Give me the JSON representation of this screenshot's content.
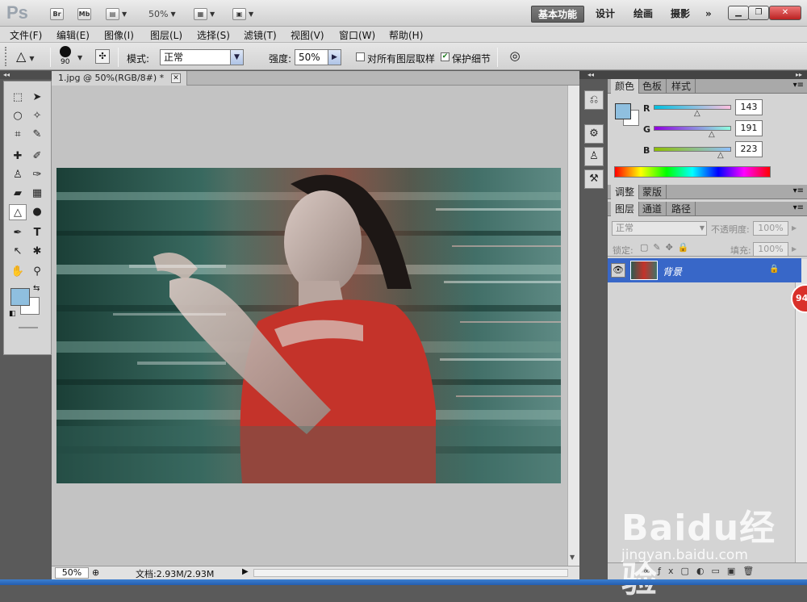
{
  "app": {
    "logo": "Ps",
    "launch_buttons": [
      "Br",
      "Mb"
    ],
    "zoom": "50%"
  },
  "workspaces": [
    "基本功能",
    "设计",
    "绘画",
    "摄影",
    "»"
  ],
  "menus": [
    "文件(F)",
    "编辑(E)",
    "图像(I)",
    "图层(L)",
    "选择(S)",
    "滤镜(T)",
    "视图(V)",
    "窗口(W)",
    "帮助(H)"
  ],
  "options": {
    "brush_size": "90",
    "mode_label": "模式:",
    "mode_value": "正常",
    "strength_label": "强度:",
    "strength_value": "50%",
    "sample_all_label": "对所有图层取样",
    "protect_detail_label": "保护细节",
    "sample_all_checked": false,
    "protect_detail_checked": true
  },
  "document": {
    "tab_title": "1.jpg @ 50%(RGB/8#) *",
    "zoom_status": "50%",
    "doc_info": "文档:2.93M/2.93M"
  },
  "color_panel": {
    "tabs": [
      "颜色",
      "色板",
      "样式"
    ],
    "channels": [
      {
        "name": "R",
        "value": "143",
        "fraction": 0.56
      },
      {
        "name": "G",
        "value": "191",
        "fraction": 0.75
      },
      {
        "name": "B",
        "value": "223",
        "fraction": 0.87
      }
    ],
    "foreground": "#8fbfdf",
    "background": "#ffffff"
  },
  "adjust_panel": {
    "tabs": [
      "调整",
      "蒙版"
    ]
  },
  "layers_panel": {
    "tabs": [
      "图层",
      "通道",
      "路径"
    ],
    "blend_mode": "正常",
    "opacity_label": "不透明度:",
    "opacity_value": "100%",
    "lock_label": "锁定:",
    "fill_label": "填充:",
    "fill_value": "100%",
    "layers": [
      {
        "name": "背景",
        "visible": true,
        "locked": true
      }
    ]
  },
  "badge": "94",
  "watermark": {
    "brand": "Baidu经验",
    "url": "jingyan.baidu.com"
  },
  "colors": {
    "accent": "#3867c8",
    "active_workspace": "#666666"
  }
}
